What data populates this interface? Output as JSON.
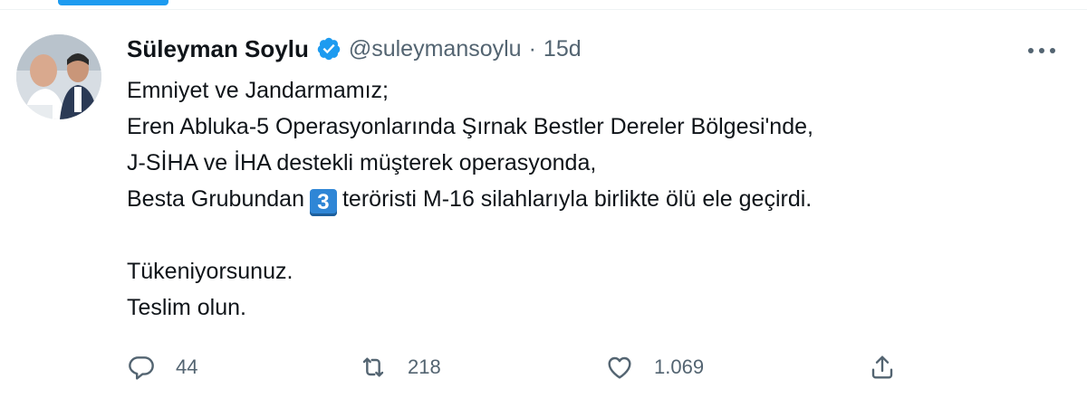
{
  "tweet": {
    "author": {
      "display_name": "Süleyman Soylu",
      "handle": "@suleymansoylu",
      "verified": true
    },
    "separator": "·",
    "time": "15d",
    "body": {
      "line1": "Emniyet ve Jandarmamız;",
      "line2": "Eren Abluka-5 Operasyonlarında Şırnak Bestler Dereler Bölgesi'nde,",
      "line3": "J-SİHA ve İHA destekli müşterek operasyonda,",
      "line4_before": "Besta Grubundan",
      "line4_keycap": "3",
      "line4_after": "teröristi M-16 silahlarıyla birlikte ölü ele geçirdi.",
      "line5": "Tükeniyorsunuz.",
      "line6": "Teslim olun."
    },
    "actions": {
      "replies": "44",
      "retweets": "218",
      "likes": "1.069"
    }
  },
  "colors": {
    "accent": "#1d9bf0",
    "text": "#0f1419",
    "muted": "#536471",
    "keycap": "#2f86d6"
  },
  "icons": [
    "verified-badge-icon",
    "more-icon",
    "reply-icon",
    "retweet-icon",
    "like-icon",
    "share-icon"
  ]
}
